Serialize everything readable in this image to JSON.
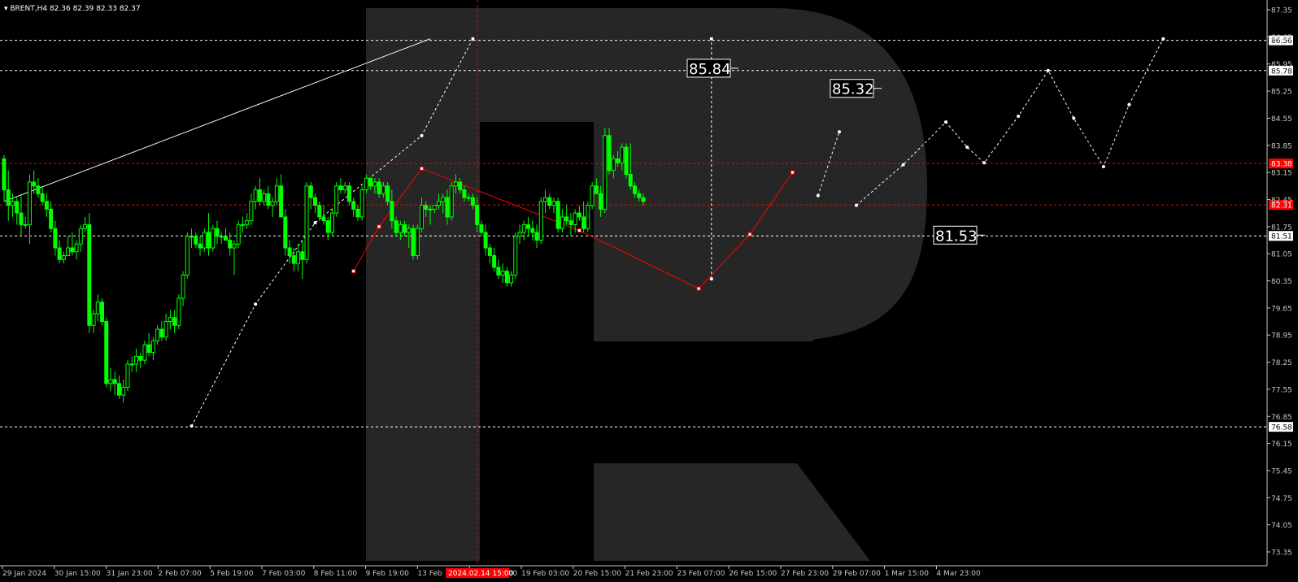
{
  "header": {
    "symbol_line": "BRENT,H4  82.36 82.39 82.33 82.37"
  },
  "chart_data": {
    "type": "candlestick",
    "symbol": "BRENT",
    "timeframe": "H4",
    "ohlc_header": {
      "open": 82.36,
      "high": 82.39,
      "low": 82.33,
      "close": 82.37
    },
    "ylim": [
      73.35,
      87.35
    ],
    "y_ticks": [
      "87.35",
      "86.65",
      "85.95",
      "85.25",
      "84.55",
      "83.85",
      "83.15",
      "82.45",
      "81.75",
      "81.05",
      "80.35",
      "79.65",
      "78.95",
      "78.25",
      "77.55",
      "76.85",
      "76.15",
      "75.45",
      "74.75",
      "74.05",
      "73.35"
    ],
    "x_ticks": [
      "29 Jan 2024",
      "30 Jan 15:00",
      "31 Jan 23:00",
      "2 Feb 07:00",
      "5 Feb 19:00",
      "7 Feb 03:00",
      "8 Feb 11:00",
      "9 Feb 19:00",
      "13 Feb",
      "15 Feb 19:00",
      "19 Feb 03:00",
      "20 Feb 15:00",
      "21 Feb 23:00",
      "23 Feb 07:00",
      "26 Feb 15:00",
      "27 Feb 23:00",
      "29 Feb 07:00",
      "1 Mar 15:00",
      "4 Mar 23:00"
    ],
    "crosshair_time": "2024.02.14 15:00",
    "levels": [
      {
        "price": 86.56,
        "label": "86.56",
        "color": "#ffffff",
        "style": "white-dashed"
      },
      {
        "price": 85.78,
        "label": "85.78",
        "color": "#ffffff",
        "style": "white-dashed"
      },
      {
        "price": 83.38,
        "label": "83.38",
        "color": "#ff0000",
        "style": "red-dashed"
      },
      {
        "price": 82.31,
        "label": "82.31",
        "color": "#ff0000",
        "style": "red-dashed"
      },
      {
        "price": 81.51,
        "label": "81.51",
        "color": "#ffffff",
        "style": "white-dashed"
      },
      {
        "price": 76.58,
        "label": "76.58",
        "color": "#ffffff",
        "style": "white-dashed"
      }
    ],
    "annotations": [
      {
        "text": "85.84",
        "price": 85.84
      },
      {
        "text": "85.32",
        "price": 85.32
      },
      {
        "text": "81.53",
        "price": 81.53
      }
    ],
    "colors": {
      "bull": "#00ff00",
      "bear": "#00ff00",
      "background": "#000000",
      "grid_text": "#c8c8c8",
      "zigzag": "#ff0000",
      "forecast": "#ffffff",
      "watermark": "#262626"
    },
    "candles": [
      [
        83.5,
        83.6,
        82.4,
        82.7
      ],
      [
        82.7,
        83.2,
        81.9,
        82.3
      ],
      [
        82.3,
        82.6,
        82.0,
        82.4
      ],
      [
        82.4,
        82.5,
        81.8,
        82.1
      ],
      [
        82.1,
        82.6,
        81.5,
        81.8
      ],
      [
        81.8,
        82.0,
        81.7,
        81.8
      ],
      [
        81.8,
        83.1,
        81.3,
        82.9
      ],
      [
        82.9,
        83.2,
        82.6,
        82.8
      ],
      [
        82.8,
        83.0,
        82.5,
        82.6
      ],
      [
        82.6,
        82.8,
        82.3,
        82.4
      ],
      [
        82.4,
        82.6,
        82.0,
        82.2
      ],
      [
        82.2,
        82.4,
        81.6,
        81.7
      ],
      [
        81.7,
        81.9,
        81.0,
        81.2
      ],
      [
        81.2,
        81.4,
        80.8,
        80.9
      ],
      [
        80.9,
        81.1,
        80.8,
        81.0
      ],
      [
        81.0,
        81.5,
        81.0,
        81.2
      ],
      [
        81.2,
        81.6,
        81.0,
        81.1
      ],
      [
        81.1,
        81.4,
        80.9,
        81.3
      ],
      [
        81.3,
        81.8,
        81.1,
        81.7
      ],
      [
        81.7,
        82.0,
        81.6,
        81.8
      ],
      [
        81.8,
        82.1,
        79.0,
        79.2
      ],
      [
        79.2,
        79.6,
        79.0,
        79.5
      ],
      [
        79.5,
        80.0,
        79.3,
        79.8
      ],
      [
        79.8,
        79.9,
        79.2,
        79.3
      ],
      [
        79.3,
        79.4,
        77.6,
        77.7
      ],
      [
        77.7,
        78.1,
        77.5,
        77.8
      ],
      [
        77.8,
        78.0,
        77.4,
        77.7
      ],
      [
        77.7,
        77.9,
        77.3,
        77.4
      ],
      [
        77.4,
        77.8,
        77.2,
        77.6
      ],
      [
        77.6,
        78.3,
        77.5,
        78.2
      ],
      [
        78.2,
        78.4,
        78.0,
        78.2
      ],
      [
        78.2,
        78.6,
        78.0,
        78.4
      ],
      [
        78.4,
        78.5,
        78.1,
        78.3
      ],
      [
        78.3,
        78.8,
        78.2,
        78.7
      ],
      [
        78.7,
        79.0,
        78.4,
        78.5
      ],
      [
        78.5,
        78.9,
        78.3,
        78.8
      ],
      [
        78.8,
        79.2,
        78.7,
        79.1
      ],
      [
        79.1,
        79.3,
        78.8,
        78.9
      ],
      [
        78.9,
        79.5,
        78.8,
        79.3
      ],
      [
        79.3,
        79.6,
        79.1,
        79.4
      ],
      [
        79.4,
        79.6,
        79.0,
        79.2
      ],
      [
        79.2,
        80.0,
        79.1,
        79.9
      ],
      [
        79.9,
        80.6,
        79.7,
        80.5
      ],
      [
        80.5,
        81.6,
        80.4,
        81.5
      ],
      [
        81.5,
        81.7,
        81.2,
        81.5
      ],
      [
        81.5,
        81.6,
        81.2,
        81.3
      ],
      [
        81.3,
        81.5,
        81.0,
        81.2
      ],
      [
        81.2,
        81.7,
        81.1,
        81.6
      ],
      [
        81.6,
        82.1,
        81.0,
        81.2
      ],
      [
        81.2,
        81.8,
        81.1,
        81.7
      ],
      [
        81.7,
        81.9,
        81.3,
        81.5
      ],
      [
        81.5,
        81.6,
        81.3,
        81.5
      ],
      [
        81.5,
        81.7,
        81.4,
        81.4
      ],
      [
        81.4,
        81.6,
        81.0,
        81.2
      ],
      [
        81.2,
        81.4,
        80.5,
        81.3
      ],
      [
        81.3,
        81.9,
        81.2,
        81.8
      ],
      [
        81.8,
        82.0,
        81.6,
        81.8
      ],
      [
        81.8,
        82.1,
        81.7,
        81.9
      ],
      [
        81.9,
        82.6,
        81.8,
        82.4
      ],
      [
        82.4,
        82.8,
        82.2,
        82.7
      ],
      [
        82.7,
        83.0,
        82.3,
        82.4
      ],
      [
        82.4,
        82.7,
        82.3,
        82.6
      ],
      [
        82.6,
        82.8,
        82.2,
        82.3
      ],
      [
        82.3,
        82.5,
        82.0,
        82.4
      ],
      [
        82.4,
        83.0,
        82.3,
        82.8
      ],
      [
        82.8,
        83.1,
        82.5,
        82.0
      ],
      [
        82.0,
        82.2,
        81.0,
        81.2
      ],
      [
        81.2,
        81.4,
        80.8,
        81.0
      ],
      [
        81.0,
        81.2,
        80.6,
        80.8
      ],
      [
        80.8,
        81.3,
        80.6,
        81.1
      ],
      [
        81.1,
        81.4,
        80.4,
        80.9
      ],
      [
        80.9,
        82.9,
        80.8,
        82.8
      ],
      [
        82.8,
        82.9,
        82.2,
        82.5
      ],
      [
        82.5,
        82.6,
        82.1,
        82.3
      ],
      [
        82.3,
        82.4,
        81.9,
        82.0
      ],
      [
        82.0,
        82.3,
        81.8,
        81.9
      ],
      [
        81.9,
        82.0,
        81.4,
        81.6
      ],
      [
        81.6,
        82.2,
        81.5,
        82.1
      ],
      [
        82.1,
        82.9,
        82.0,
        82.8
      ],
      [
        82.8,
        83.0,
        82.6,
        82.7
      ],
      [
        82.7,
        82.9,
        82.6,
        82.8
      ],
      [
        82.8,
        82.9,
        82.3,
        82.4
      ],
      [
        82.4,
        82.5,
        82.0,
        82.2
      ],
      [
        82.2,
        82.3,
        81.9,
        82.0
      ],
      [
        82.0,
        82.8,
        81.9,
        82.7
      ],
      [
        82.7,
        83.1,
        82.6,
        83.0
      ],
      [
        83.0,
        83.0,
        82.7,
        82.8
      ],
      [
        82.8,
        83.0,
        82.6,
        82.9
      ],
      [
        82.9,
        83.0,
        82.5,
        82.6
      ],
      [
        82.6,
        82.9,
        82.5,
        82.8
      ],
      [
        82.8,
        82.9,
        82.3,
        82.4
      ],
      [
        82.4,
        82.7,
        81.7,
        81.9
      ],
      [
        81.9,
        82.0,
        81.5,
        81.6
      ],
      [
        81.6,
        81.9,
        81.4,
        81.8
      ],
      [
        81.8,
        81.9,
        81.5,
        81.6
      ],
      [
        81.6,
        81.8,
        81.2,
        81.7
      ],
      [
        81.7,
        81.8,
        80.9,
        81.0
      ],
      [
        81.0,
        81.8,
        80.9,
        81.7
      ],
      [
        81.7,
        82.5,
        81.6,
        82.3
      ],
      [
        82.3,
        82.4,
        82.0,
        82.2
      ],
      [
        82.2,
        82.3,
        81.8,
        82.2
      ],
      [
        82.2,
        82.3,
        82.1,
        82.3
      ],
      [
        82.3,
        82.6,
        82.2,
        82.4
      ],
      [
        82.4,
        82.6,
        82.1,
        82.5
      ],
      [
        82.5,
        82.7,
        81.8,
        82.0
      ],
      [
        82.0,
        82.9,
        81.9,
        82.8
      ],
      [
        82.8,
        83.1,
        82.6,
        82.9
      ],
      [
        82.9,
        83.0,
        82.6,
        82.7
      ],
      [
        82.7,
        82.8,
        82.4,
        82.5
      ],
      [
        82.5,
        82.6,
        82.4,
        82.5
      ],
      [
        82.5,
        82.6,
        82.2,
        82.3
      ],
      [
        82.3,
        82.5,
        81.6,
        81.8
      ],
      [
        81.8,
        81.9,
        81.5,
        81.6
      ],
      [
        81.6,
        81.8,
        81.0,
        81.2
      ],
      [
        81.2,
        81.3,
        80.8,
        81.0
      ],
      [
        81.0,
        81.2,
        80.6,
        80.7
      ],
      [
        80.7,
        80.9,
        80.4,
        80.5
      ],
      [
        80.5,
        80.8,
        80.3,
        80.6
      ],
      [
        80.6,
        80.7,
        80.2,
        80.3
      ],
      [
        80.3,
        80.6,
        80.2,
        80.5
      ],
      [
        80.5,
        81.6,
        80.4,
        81.5
      ],
      [
        81.5,
        81.8,
        81.3,
        81.6
      ],
      [
        81.6,
        81.9,
        81.4,
        81.8
      ],
      [
        81.8,
        82.0,
        81.5,
        81.7
      ],
      [
        81.7,
        81.9,
        81.4,
        81.6
      ],
      [
        81.6,
        81.8,
        81.2,
        81.4
      ],
      [
        81.4,
        82.5,
        81.3,
        82.4
      ],
      [
        82.4,
        82.7,
        82.1,
        82.5
      ],
      [
        82.5,
        82.6,
        82.2,
        82.3
      ],
      [
        82.3,
        82.5,
        82.1,
        82.4
      ],
      [
        82.4,
        82.5,
        81.6,
        81.7
      ],
      [
        81.7,
        82.2,
        81.6,
        82.0
      ],
      [
        82.0,
        82.3,
        81.8,
        81.9
      ],
      [
        81.9,
        82.1,
        81.5,
        81.8
      ],
      [
        81.8,
        82.2,
        81.6,
        82.1
      ],
      [
        82.1,
        82.3,
        81.9,
        82.0
      ],
      [
        82.0,
        82.4,
        81.6,
        81.7
      ],
      [
        81.7,
        82.4,
        81.6,
        82.3
      ],
      [
        82.3,
        82.9,
        82.2,
        82.8
      ],
      [
        82.8,
        83.0,
        82.6,
        82.6
      ],
      [
        82.6,
        82.8,
        82.0,
        82.2
      ],
      [
        82.2,
        84.3,
        82.1,
        84.1
      ],
      [
        84.1,
        84.3,
        83.1,
        83.2
      ],
      [
        83.2,
        83.6,
        83.0,
        83.5
      ],
      [
        83.5,
        83.7,
        83.3,
        83.4
      ],
      [
        83.4,
        83.9,
        83.2,
        83.8
      ],
      [
        83.8,
        83.9,
        83.0,
        83.1
      ],
      [
        83.1,
        83.9,
        82.7,
        82.8
      ],
      [
        82.8,
        82.9,
        82.5,
        82.6
      ],
      [
        82.6,
        82.7,
        82.4,
        82.5
      ],
      [
        82.5,
        82.6,
        82.3,
        82.4
      ]
    ],
    "zigzag_red": [
      [
        82,
        80.6
      ],
      [
        88,
        81.75
      ],
      [
        98,
        83.25
      ],
      [
        135,
        81.65
      ],
      [
        163,
        80.15
      ],
      [
        175,
        81.55
      ],
      [
        185,
        83.15
      ]
    ],
    "forecast_white": [
      [
        [
          44,
          76.6
        ],
        [
          59,
          79.75
        ],
        [
          73,
          81.85
        ],
        [
          98,
          84.1
        ],
        [
          110,
          86.6
        ]
      ],
      [
        [
          166,
          80.4
        ],
        [
          166,
          86.6
        ]
      ],
      [
        [
          191,
          82.55
        ],
        [
          196,
          84.2
        ]
      ],
      [
        [
          200,
          82.3
        ],
        [
          211,
          83.35
        ],
        [
          221,
          84.45
        ],
        [
          226,
          83.8
        ],
        [
          230,
          83.4
        ],
        [
          238,
          84.6
        ],
        [
          245,
          85.78
        ],
        [
          251,
          84.55
        ],
        [
          258,
          83.3
        ],
        [
          264,
          84.9
        ],
        [
          272,
          86.6
        ]
      ]
    ],
    "trendline_white": [
      [
        0,
        82.4
      ],
      [
        100,
        86.6
      ]
    ]
  }
}
